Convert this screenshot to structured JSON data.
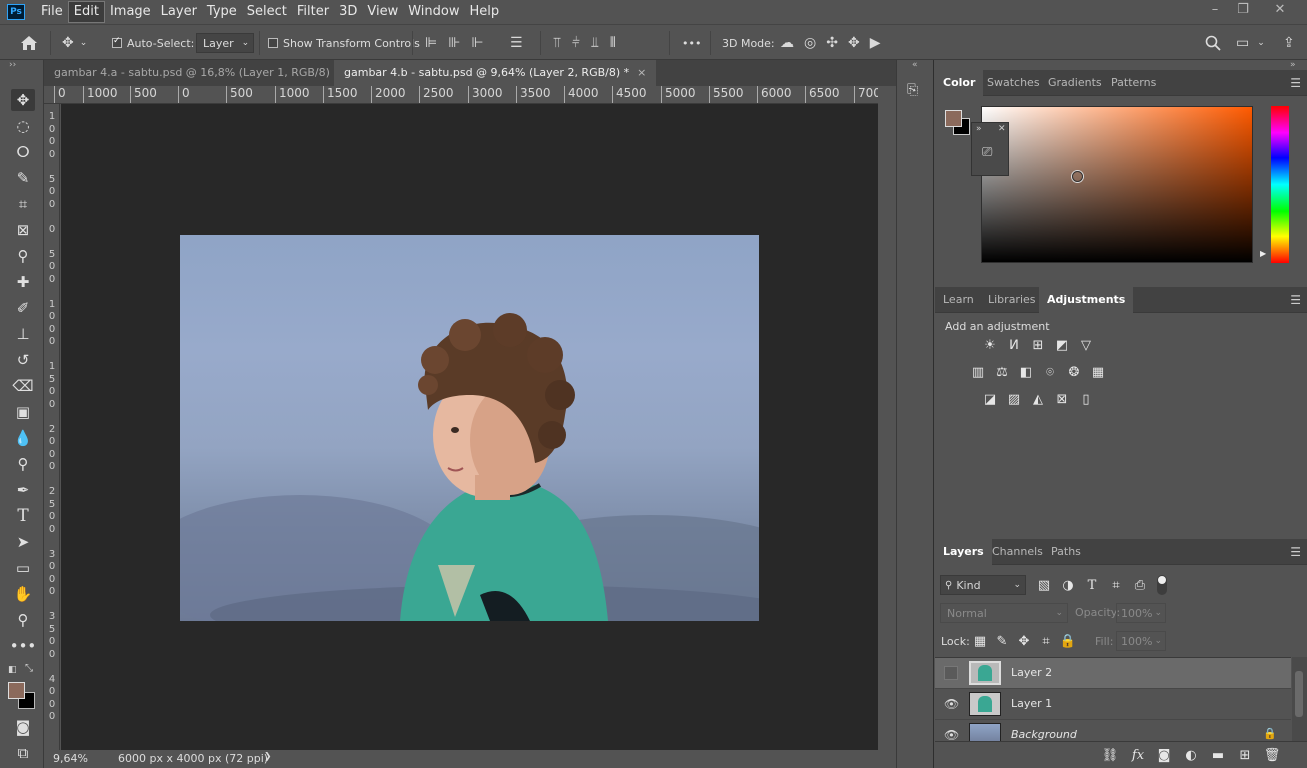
{
  "app": {
    "logo": "Ps"
  },
  "menu": [
    "File",
    "Edit",
    "Image",
    "Layer",
    "Type",
    "Select",
    "Filter",
    "3D",
    "View",
    "Window",
    "Help"
  ],
  "options": {
    "auto_select_label": "Auto-Select:",
    "auto_select_value": "Layer",
    "show_transform_label": "Show Transform Controls",
    "three_d_mode_label": "3D Mode:",
    "more": "•••"
  },
  "tabs": [
    {
      "title": "gambar 4.a - sabtu.psd @ 16,8% (Layer 1, RGB/8)"
    },
    {
      "title": "gambar 4.b - sabtu.psd @ 9,64% (Layer 2, RGB/8) *"
    }
  ],
  "ruler_h": [
    "0",
    "1000",
    "500",
    "0",
    "500",
    "1000",
    "1500",
    "2000",
    "2500",
    "3000",
    "3500",
    "4000",
    "4500",
    "5000",
    "5500",
    "6000",
    "6500",
    "700"
  ],
  "status": {
    "zoom": "9,64%",
    "doc_info": "6000 px x 4000 px (72 ppi)",
    "arrow": "❯"
  },
  "color_panel": {
    "tabs": [
      "Color",
      "Swatches",
      "Gradients",
      "Patterns"
    ],
    "foreground": "#8b6a5c",
    "background": "#000000"
  },
  "adjust_panel": {
    "tabs": [
      "Learn",
      "Libraries",
      "Adjustments"
    ],
    "heading": "Add an adjustment"
  },
  "layers_panel": {
    "tabs": [
      "Layers",
      "Channels",
      "Paths"
    ],
    "filter_kind": "Kind",
    "blend_mode": "Normal",
    "opacity_label": "Opacity:",
    "opacity_value": "100%",
    "lock_label": "Lock:",
    "fill_label": "Fill:",
    "fill_value": "100%",
    "layers": [
      {
        "name": "Layer 2",
        "visible": false,
        "selected": true
      },
      {
        "name": "Layer 1",
        "visible": true,
        "selected": false
      },
      {
        "name": "Background",
        "visible": true,
        "selected": false
      }
    ]
  }
}
